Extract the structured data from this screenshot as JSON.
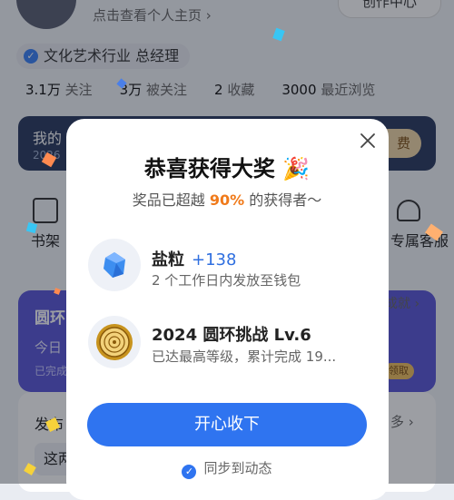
{
  "profile": {
    "subtitle": "点击查看个人主页 ›",
    "creator_btn": "创作中心",
    "job_badge": "文化艺术行业 总经理",
    "stats": [
      {
        "value": "3.1万",
        "label": "关注"
      },
      {
        "value": "3万",
        "label": "被关注"
      },
      {
        "value": "2",
        "label": "收藏"
      },
      {
        "value": "3000",
        "label": "最近浏览"
      }
    ],
    "vip_text": "我的",
    "vip_year": "2026",
    "vip_pill": "费",
    "shelf_label": "书架",
    "cs_label": "专属客服",
    "ring_title": "圆环",
    "ring_sub": "今日",
    "ring_sub2": "已完成",
    "ach_link": "成就 ›",
    "reward_chip": "领取",
    "post_title": "发布",
    "post_more": "多 ›",
    "post_item": "这两"
  },
  "modal": {
    "title": "恭喜获得大奖",
    "title_emoji": "🎉",
    "subtitle_prefix": "奖品已超越",
    "subtitle_pct": "90%",
    "subtitle_suffix": "的获得者～",
    "items": [
      {
        "title": "盐粒",
        "extra": "+138",
        "sub": "2 个工作日内发放至钱包",
        "icon": "salt-crystal-icon"
      },
      {
        "title": "2024 圆环挑战 Lv.6",
        "extra": "",
        "sub": "已达最高等级，累计完成 19...",
        "icon": "ring-medal-icon"
      }
    ],
    "cta": "开心收下",
    "sync": "同步到动态"
  },
  "colors": {
    "accent": "#2f74f0",
    "highlight": "#f07a1a"
  }
}
